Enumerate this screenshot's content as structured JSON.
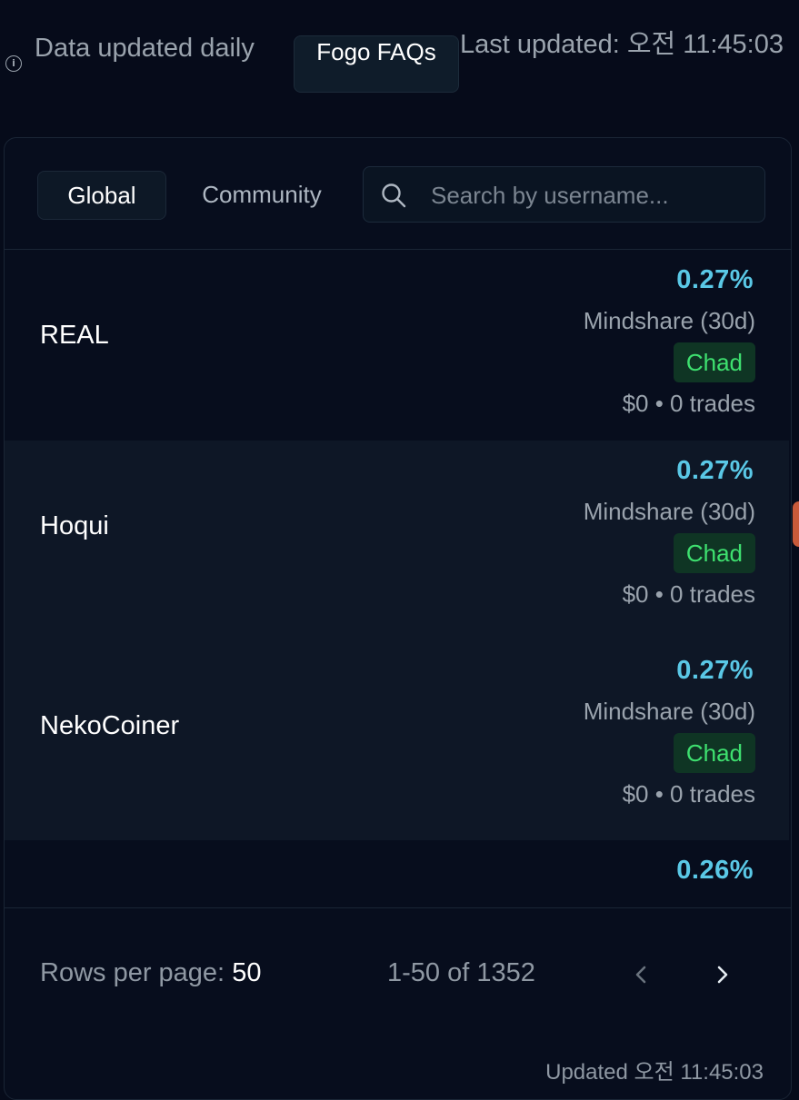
{
  "header": {
    "info_text": "Data updated daily",
    "faq_button": "Fogo FAQs",
    "last_updated": "Last updated: 오전 11:45:03"
  },
  "tabs": [
    {
      "label": "Global",
      "active": true
    },
    {
      "label": "Community",
      "active": false
    }
  ],
  "search": {
    "placeholder": "Search by username..."
  },
  "rows": [
    {
      "name": "REAL",
      "mindshare": "0.27%",
      "mindshare_label": "Mindshare (30d)",
      "badge": "Chad",
      "stats": "$0 • 0 trades"
    },
    {
      "name": "Hoqui",
      "mindshare": "0.27%",
      "mindshare_label": "Mindshare (30d)",
      "badge": "Chad",
      "stats": "$0 • 0 trades"
    },
    {
      "name": "NekoCoiner",
      "mindshare": "0.27%",
      "mindshare_label": "Mindshare (30d)",
      "badge": "Chad",
      "stats": "$0 • 0 trades"
    },
    {
      "name": "",
      "mindshare": "0.26%"
    }
  ],
  "footer": {
    "rows_per_page_label": "Rows per page:",
    "rows_per_page_value": "50",
    "range": "1-50 of 1352",
    "updated": "Updated 오전 11:45:03"
  },
  "colors": {
    "accent": "#5ac8e6",
    "badge_bg": "#0f3524",
    "badge_text": "#3ee06f",
    "background": "#060b1a"
  },
  "icons": {
    "info": "info-icon",
    "search": "search-icon",
    "prev": "chevron-left-icon",
    "next": "chevron-right-icon"
  }
}
